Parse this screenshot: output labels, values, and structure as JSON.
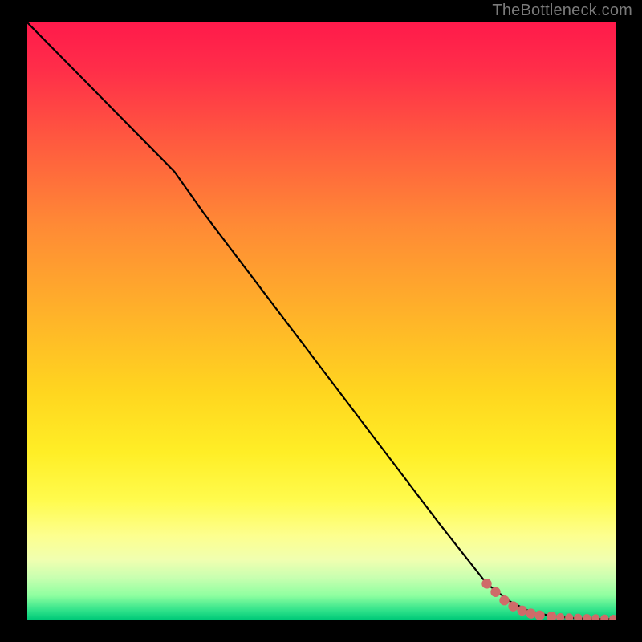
{
  "watermark": "TheBottleneck.com",
  "colors": {
    "page_bg": "#000000",
    "curve": "#000000",
    "dot": "#cf6b69",
    "gradient_top": "#ff1a4b",
    "gradient_mid": "#ffee26",
    "gradient_bottom": "#00c978"
  },
  "chart_data": {
    "type": "line",
    "title": "",
    "xlabel": "",
    "ylabel": "",
    "xlim": [
      0,
      100
    ],
    "ylim": [
      0,
      100
    ],
    "grid": false,
    "legend": "none",
    "annotations": [],
    "series": [
      {
        "name": "bottleneck-curve",
        "x": [
          0,
          10,
          20,
          25,
          30,
          40,
          50,
          60,
          70,
          78,
          82,
          85,
          88,
          90,
          92,
          94,
          96,
          98,
          100
        ],
        "y": [
          100,
          90,
          80,
          75,
          68,
          55,
          42,
          29,
          16,
          6,
          3,
          1.5,
          0.8,
          0.5,
          0.3,
          0.2,
          0.15,
          0.1,
          0.05
        ]
      }
    ],
    "highlighted_points": [
      {
        "x": 78,
        "y": 6.0
      },
      {
        "x": 79.5,
        "y": 4.6
      },
      {
        "x": 81,
        "y": 3.2
      },
      {
        "x": 82.5,
        "y": 2.2
      },
      {
        "x": 84,
        "y": 1.5
      },
      {
        "x": 85.5,
        "y": 1.0
      },
      {
        "x": 87,
        "y": 0.7
      },
      {
        "x": 89,
        "y": 0.5
      },
      {
        "x": 90.5,
        "y": 0.4
      },
      {
        "x": 92,
        "y": 0.35
      },
      {
        "x": 93.5,
        "y": 0.3
      },
      {
        "x": 95,
        "y": 0.25
      },
      {
        "x": 96.5,
        "y": 0.2
      },
      {
        "x": 98,
        "y": 0.15
      },
      {
        "x": 99.5,
        "y": 0.1
      }
    ]
  }
}
